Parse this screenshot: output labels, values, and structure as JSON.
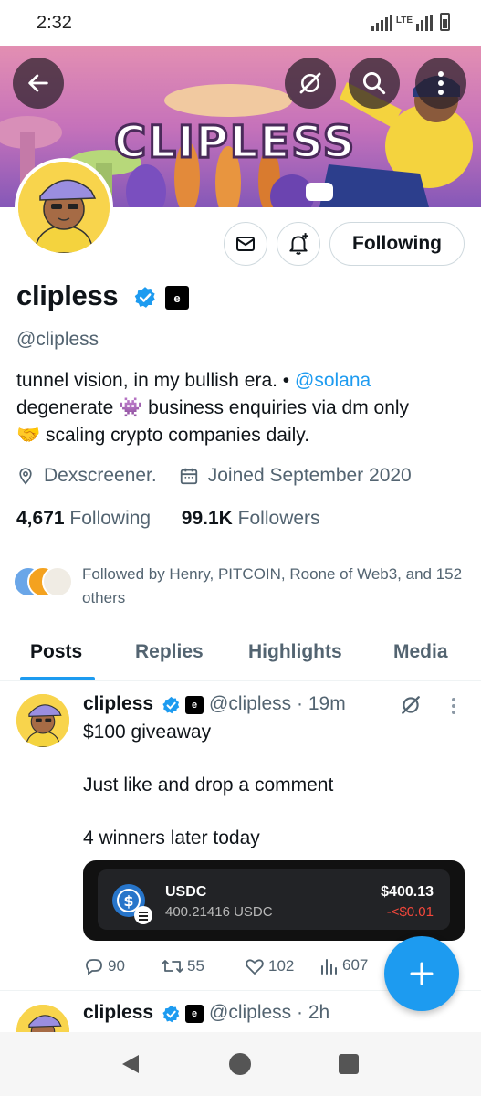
{
  "status_bar": {
    "time": "2:32",
    "network": "LTE"
  },
  "banner": {
    "text": "CLIPLESS"
  },
  "profile": {
    "display_name": "clipless",
    "affiliate_badge": "e",
    "handle": "@clipless",
    "bio_line1": "tunnel vision, in my bullish era. • ",
    "bio_mention": "@solana",
    "bio_line2": "degenerate 👾 business enquiries via dm only",
    "bio_line3": "🤝 scaling crypto companies daily.",
    "location": "Dexscreener.",
    "joined": "Joined September 2020",
    "following_count": "4,671",
    "following_label": " Following",
    "followers_count": "99.1K",
    "followers_label": " Followers",
    "followed_by": "Followed by Henry, PITCOIN, Roone of Web3, and 152 others",
    "follow_button": "Following"
  },
  "tabs": [
    {
      "label": "Posts",
      "active": true
    },
    {
      "label": "Replies",
      "active": false
    },
    {
      "label": "Highlights",
      "active": false
    },
    {
      "label": "Media",
      "active": false
    }
  ],
  "posts": [
    {
      "name": "clipless",
      "handle": "@clipless · 19m",
      "line1": "$100 giveaway",
      "line2": "Just like and drop a comment",
      "line3": "4 winners later today",
      "card": {
        "token": "USDC",
        "amount": "400.21416 USDC",
        "usd_value": "$400.13",
        "change": "-<$0.01"
      },
      "replies": "90",
      "reposts": "55",
      "likes": "102",
      "views": "607"
    },
    {
      "name": "clipless",
      "handle": "@clipless · 2h"
    }
  ],
  "colors": {
    "accent": "#1d9bf0",
    "text": "#0f1419",
    "muted": "#536471",
    "negative": "#f4473b"
  }
}
